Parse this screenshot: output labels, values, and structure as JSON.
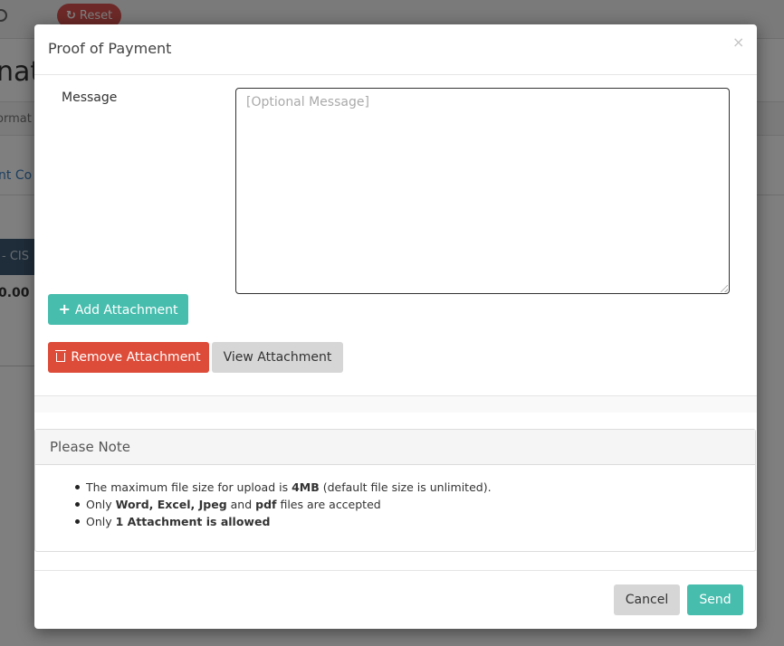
{
  "background": {
    "reset_label": "Reset",
    "heading_fragment": "natio",
    "tab_fragment": "ormat",
    "link_fragment": "nt Co",
    "column_fragment": "- CIS",
    "value_fragment": "0.00"
  },
  "modal": {
    "title": "Proof of Payment",
    "close": "×",
    "message": {
      "label": "Message",
      "placeholder": "[Optional Message]",
      "value": ""
    },
    "buttons": {
      "add_attachment": "Add Attachment",
      "remove_attachment": "Remove Attachment",
      "view_attachment": "View Attachment",
      "cancel": "Cancel",
      "send": "Send"
    },
    "note": {
      "title": "Please Note",
      "items": [
        {
          "prefix": "The maximum file size for upload is ",
          "bold": "4MB",
          "suffix": " (default file size is unlimited)."
        },
        {
          "prefix": "Only ",
          "bold": "Word, Excel, Jpeg",
          "mid": " and ",
          "bold2": "pdf",
          "suffix": " files are accepted"
        },
        {
          "prefix": "Only ",
          "bold": "1 Attachment is allowed",
          "suffix": ""
        }
      ]
    }
  },
  "colors": {
    "primary_teal": "#47bdae",
    "danger_red": "#dd4b39",
    "neutral_gray": "#d6d6d6"
  },
  "icons": {
    "add": "plus-icon",
    "remove": "trash-icon",
    "close": "close-icon",
    "reset": "refresh-icon"
  }
}
